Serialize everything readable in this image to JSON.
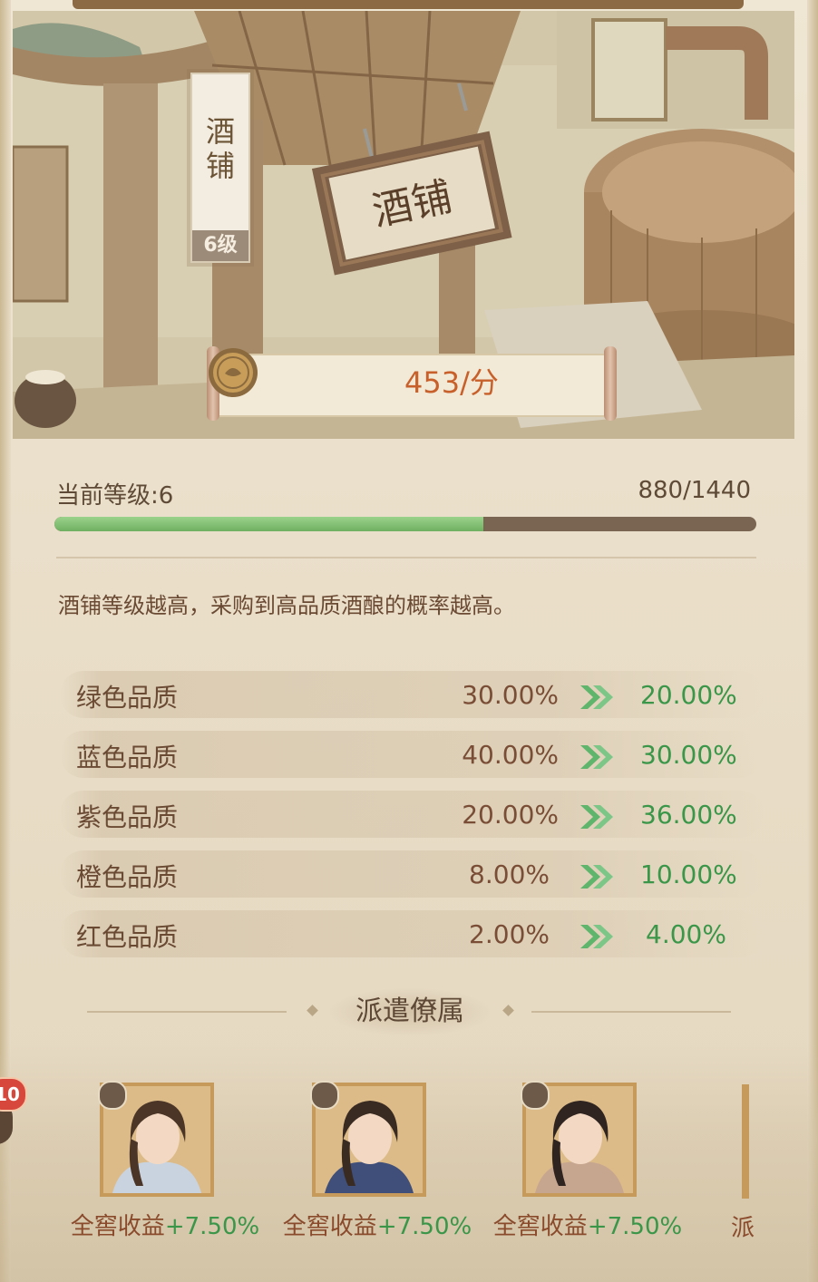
{
  "building": {
    "name": "酒铺",
    "level_tag": "6级",
    "sign_text": "酒铺",
    "income_rate": "453/分"
  },
  "level": {
    "label": "当前等级:6",
    "exp_text": "880/1440",
    "progress": 0.611
  },
  "description": "酒铺等级越高，采购到高品质酒酿的概率越高。",
  "qualities": [
    {
      "name": "绿色品质",
      "current": "30.00%",
      "next": "20.00%"
    },
    {
      "name": "蓝色品质",
      "current": "40.00%",
      "next": "30.00%"
    },
    {
      "name": "紫色品质",
      "current": "20.00%",
      "next": "36.00%"
    },
    {
      "name": "橙色品质",
      "current": "8.00%",
      "next": "10.00%"
    },
    {
      "name": "红色品质",
      "current": "2.00%",
      "next": "4.00%"
    }
  ],
  "dispatch": {
    "title": "派遣僚属",
    "badge": "10",
    "retainers": [
      {
        "type_icon": "fan-icon",
        "bonus_label": "全窖收益",
        "bonus_value": "+7.50%"
      },
      {
        "type_icon": "lion-icon",
        "bonus_label": "全窖收益",
        "bonus_value": "+7.50%"
      },
      {
        "type_icon": "lion-icon",
        "bonus_label": "全窖收益",
        "bonus_value": "+7.50%"
      }
    ],
    "partial_text": "派"
  },
  "colors": {
    "increase_green": "#3a9648",
    "value_brown": "#7a4e36",
    "rate_orange": "#c7602a",
    "exp_fill": "#6fb062"
  }
}
